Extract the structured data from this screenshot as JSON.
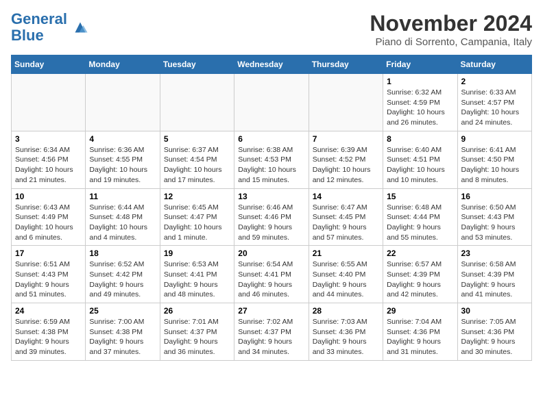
{
  "logo": {
    "line1": "General",
    "line2": "Blue"
  },
  "title": "November 2024",
  "location": "Piano di Sorrento, Campania, Italy",
  "weekdays": [
    "Sunday",
    "Monday",
    "Tuesday",
    "Wednesday",
    "Thursday",
    "Friday",
    "Saturday"
  ],
  "weeks": [
    [
      {
        "day": "",
        "info": ""
      },
      {
        "day": "",
        "info": ""
      },
      {
        "day": "",
        "info": ""
      },
      {
        "day": "",
        "info": ""
      },
      {
        "day": "",
        "info": ""
      },
      {
        "day": "1",
        "info": "Sunrise: 6:32 AM\nSunset: 4:59 PM\nDaylight: 10 hours and 26 minutes."
      },
      {
        "day": "2",
        "info": "Sunrise: 6:33 AM\nSunset: 4:57 PM\nDaylight: 10 hours and 24 minutes."
      }
    ],
    [
      {
        "day": "3",
        "info": "Sunrise: 6:34 AM\nSunset: 4:56 PM\nDaylight: 10 hours and 21 minutes."
      },
      {
        "day": "4",
        "info": "Sunrise: 6:36 AM\nSunset: 4:55 PM\nDaylight: 10 hours and 19 minutes."
      },
      {
        "day": "5",
        "info": "Sunrise: 6:37 AM\nSunset: 4:54 PM\nDaylight: 10 hours and 17 minutes."
      },
      {
        "day": "6",
        "info": "Sunrise: 6:38 AM\nSunset: 4:53 PM\nDaylight: 10 hours and 15 minutes."
      },
      {
        "day": "7",
        "info": "Sunrise: 6:39 AM\nSunset: 4:52 PM\nDaylight: 10 hours and 12 minutes."
      },
      {
        "day": "8",
        "info": "Sunrise: 6:40 AM\nSunset: 4:51 PM\nDaylight: 10 hours and 10 minutes."
      },
      {
        "day": "9",
        "info": "Sunrise: 6:41 AM\nSunset: 4:50 PM\nDaylight: 10 hours and 8 minutes."
      }
    ],
    [
      {
        "day": "10",
        "info": "Sunrise: 6:43 AM\nSunset: 4:49 PM\nDaylight: 10 hours and 6 minutes."
      },
      {
        "day": "11",
        "info": "Sunrise: 6:44 AM\nSunset: 4:48 PM\nDaylight: 10 hours and 4 minutes."
      },
      {
        "day": "12",
        "info": "Sunrise: 6:45 AM\nSunset: 4:47 PM\nDaylight: 10 hours and 1 minute."
      },
      {
        "day": "13",
        "info": "Sunrise: 6:46 AM\nSunset: 4:46 PM\nDaylight: 9 hours and 59 minutes."
      },
      {
        "day": "14",
        "info": "Sunrise: 6:47 AM\nSunset: 4:45 PM\nDaylight: 9 hours and 57 minutes."
      },
      {
        "day": "15",
        "info": "Sunrise: 6:48 AM\nSunset: 4:44 PM\nDaylight: 9 hours and 55 minutes."
      },
      {
        "day": "16",
        "info": "Sunrise: 6:50 AM\nSunset: 4:43 PM\nDaylight: 9 hours and 53 minutes."
      }
    ],
    [
      {
        "day": "17",
        "info": "Sunrise: 6:51 AM\nSunset: 4:43 PM\nDaylight: 9 hours and 51 minutes."
      },
      {
        "day": "18",
        "info": "Sunrise: 6:52 AM\nSunset: 4:42 PM\nDaylight: 9 hours and 49 minutes."
      },
      {
        "day": "19",
        "info": "Sunrise: 6:53 AM\nSunset: 4:41 PM\nDaylight: 9 hours and 48 minutes."
      },
      {
        "day": "20",
        "info": "Sunrise: 6:54 AM\nSunset: 4:41 PM\nDaylight: 9 hours and 46 minutes."
      },
      {
        "day": "21",
        "info": "Sunrise: 6:55 AM\nSunset: 4:40 PM\nDaylight: 9 hours and 44 minutes."
      },
      {
        "day": "22",
        "info": "Sunrise: 6:57 AM\nSunset: 4:39 PM\nDaylight: 9 hours and 42 minutes."
      },
      {
        "day": "23",
        "info": "Sunrise: 6:58 AM\nSunset: 4:39 PM\nDaylight: 9 hours and 41 minutes."
      }
    ],
    [
      {
        "day": "24",
        "info": "Sunrise: 6:59 AM\nSunset: 4:38 PM\nDaylight: 9 hours and 39 minutes."
      },
      {
        "day": "25",
        "info": "Sunrise: 7:00 AM\nSunset: 4:38 PM\nDaylight: 9 hours and 37 minutes."
      },
      {
        "day": "26",
        "info": "Sunrise: 7:01 AM\nSunset: 4:37 PM\nDaylight: 9 hours and 36 minutes."
      },
      {
        "day": "27",
        "info": "Sunrise: 7:02 AM\nSunset: 4:37 PM\nDaylight: 9 hours and 34 minutes."
      },
      {
        "day": "28",
        "info": "Sunrise: 7:03 AM\nSunset: 4:36 PM\nDaylight: 9 hours and 33 minutes."
      },
      {
        "day": "29",
        "info": "Sunrise: 7:04 AM\nSunset: 4:36 PM\nDaylight: 9 hours and 31 minutes."
      },
      {
        "day": "30",
        "info": "Sunrise: 7:05 AM\nSunset: 4:36 PM\nDaylight: 9 hours and 30 minutes."
      }
    ]
  ]
}
